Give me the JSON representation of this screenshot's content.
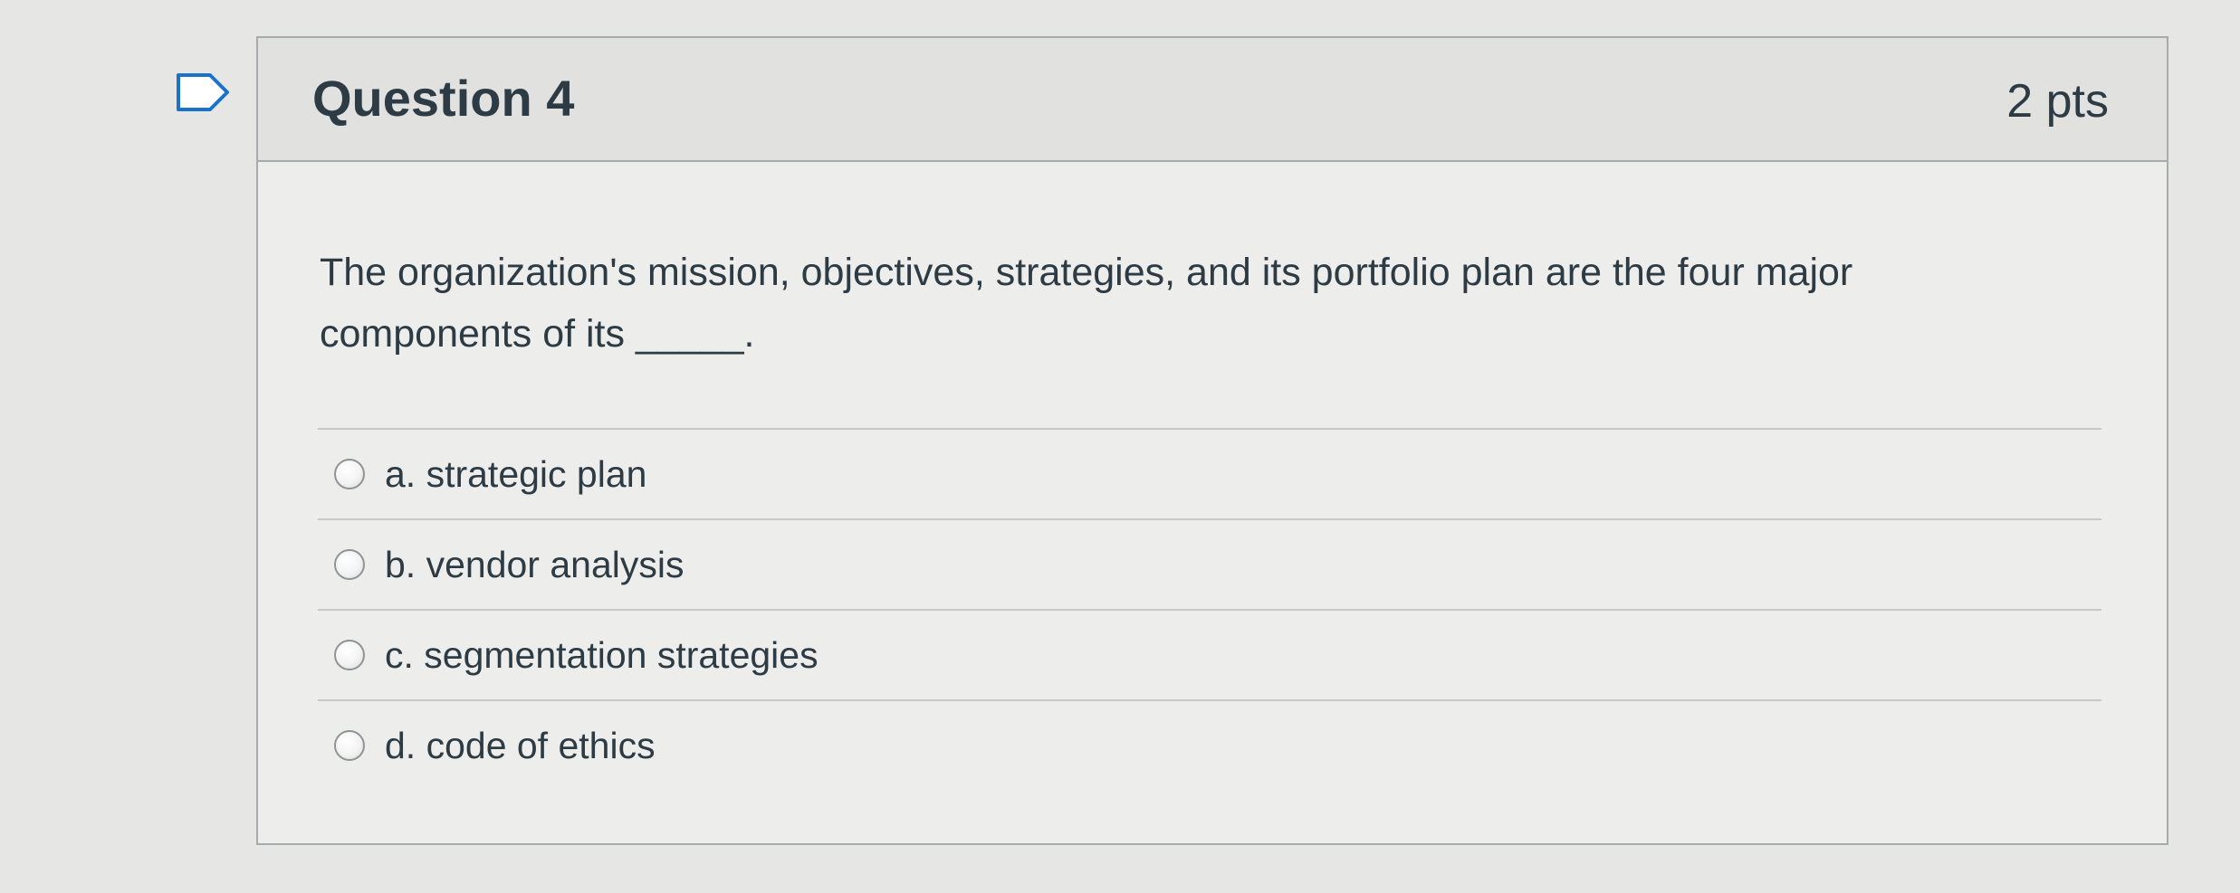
{
  "question": {
    "title": "Question 4",
    "points": "2 pts",
    "flag_icon": "bookmark-flag-icon",
    "text": "The organization's mission, objectives, strategies, and its portfolio plan are the four major components of its _____.",
    "answers": [
      {
        "label": "a. strategic plan",
        "selected": false
      },
      {
        "label": "b. vendor analysis",
        "selected": false
      },
      {
        "label": "c. segmentation strategies",
        "selected": false
      },
      {
        "label": "d. code of ethics",
        "selected": false
      }
    ]
  },
  "colors": {
    "page_background": "#e6e6e4",
    "card_background": "#ededeb",
    "header_background": "#e1e1df",
    "border": "#a8abae",
    "text": "#2d3b45"
  }
}
